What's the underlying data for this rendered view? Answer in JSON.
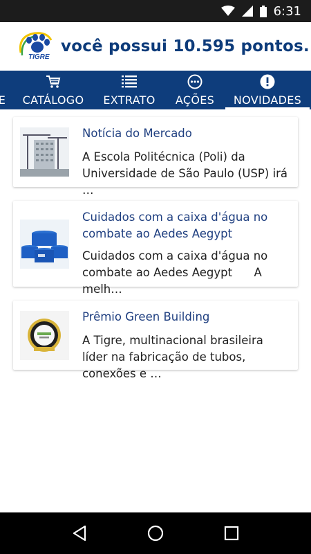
{
  "status_bar": {
    "time": "6:31"
  },
  "header": {
    "brand_text": "TIGRE",
    "points_text": "você possui 10.595 pontos."
  },
  "tabs": [
    {
      "label": "E",
      "icon": "none"
    },
    {
      "label": "CATÁLOGO",
      "icon": "cart-icon"
    },
    {
      "label": "EXTRATO",
      "icon": "list-icon"
    },
    {
      "label": "AÇÕES",
      "icon": "more-circle-icon"
    },
    {
      "label": "NOVIDADES",
      "icon": "alert-circle-icon",
      "active": true
    }
  ],
  "news": [
    {
      "title": "Notícia do Mercado",
      "description": "A Escola Politécnica (Poli) da Universidade de São Paulo (USP) irá …",
      "thumb": "building-crane-image"
    },
    {
      "title": "Cuidados com a caixa d'água no combate ao Aedes Aegypt",
      "description": "Cuidados com a caixa d'água no combate ao Aedes Aegypt      A melh…",
      "thumb": "water-tanks-image"
    },
    {
      "title": "Prêmio Green Building",
      "description": "A Tigre, multinacional brasileira líder na fabricação de tubos, conexões e …",
      "thumb": "green-building-seal-image"
    }
  ],
  "colors": {
    "primary": "#0e3d7c",
    "title_text": "#1f3f80",
    "accent_yellow": "#f2c500"
  }
}
